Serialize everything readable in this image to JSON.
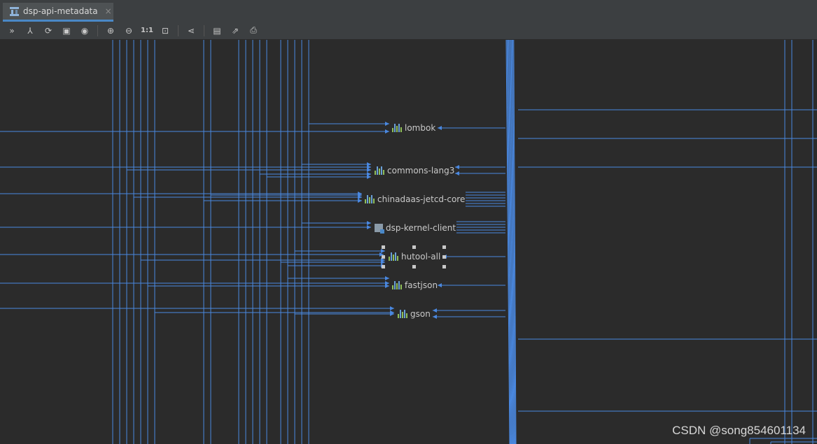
{
  "tab": {
    "title": "dsp-api-metadata",
    "close": "×",
    "icon": "diagram-icon"
  },
  "toolbar": {
    "buttons": [
      {
        "name": "collapse-icon",
        "glyph": "»"
      },
      {
        "name": "hierarchy-icon",
        "glyph": "⅄"
      },
      {
        "name": "refresh-icon",
        "glyph": "⟳"
      },
      {
        "name": "fit-content-icon",
        "glyph": "▣"
      },
      {
        "name": "view-icon",
        "glyph": "◉"
      },
      {
        "name": "zoom-in-icon",
        "glyph": "⊕"
      },
      {
        "name": "zoom-out-icon",
        "glyph": "⊖"
      },
      {
        "name": "actual-size-button",
        "glyph": "1:1"
      },
      {
        "name": "fit-page-icon",
        "glyph": "⊡"
      },
      {
        "name": "layout-icon",
        "glyph": "⋖"
      },
      {
        "name": "save-icon",
        "glyph": "▤"
      },
      {
        "name": "export-icon",
        "glyph": "⇗"
      },
      {
        "name": "print-icon",
        "glyph": "⎙"
      }
    ]
  },
  "nodes": [
    {
      "label": "lombok",
      "kind": "library"
    },
    {
      "label": "commons-lang3",
      "kind": "library"
    },
    {
      "label": "chinadaas-jetcd-core",
      "kind": "library"
    },
    {
      "label": "dsp-kernel-client",
      "kind": "module"
    },
    {
      "label": "hutool-all",
      "kind": "library",
      "selected": true
    },
    {
      "label": "fastjson",
      "kind": "library"
    },
    {
      "label": "gson",
      "kind": "library"
    }
  ],
  "colors": {
    "edge": "#4a88e0",
    "background": "#2b2b2b",
    "toolbar": "#3c3f41"
  },
  "watermark": "CSDN @song854601134"
}
